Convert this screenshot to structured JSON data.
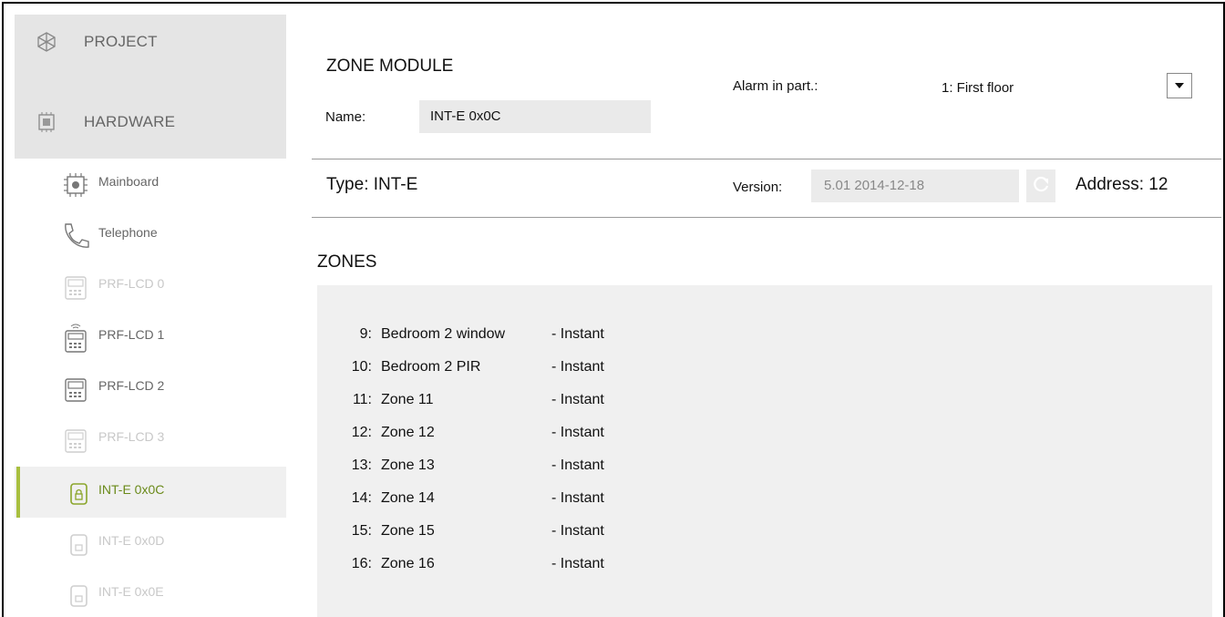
{
  "sidebar": {
    "project_label": "PROJECT",
    "hardware_label": "HARDWARE",
    "items": [
      {
        "label": "Mainboard",
        "icon": "mainboard-icon",
        "state": "normal"
      },
      {
        "label": "Telephone",
        "icon": "telephone-icon",
        "state": "normal"
      },
      {
        "label": "PRF-LCD 0",
        "icon": "keypad-icon",
        "state": "dim"
      },
      {
        "label": "PRF-LCD 1",
        "icon": "wireless-keypad-icon",
        "state": "normal"
      },
      {
        "label": "PRF-LCD 2",
        "icon": "keypad-icon",
        "state": "normal"
      },
      {
        "label": "PRF-LCD 3",
        "icon": "keypad-icon",
        "state": "dim"
      },
      {
        "label": "INT-E 0x0C",
        "icon": "module-icon",
        "state": "active"
      },
      {
        "label": "INT-E 0x0D",
        "icon": "module-icon",
        "state": "dim"
      },
      {
        "label": "INT-E 0x0E",
        "icon": "module-icon",
        "state": "dim"
      }
    ],
    "accent_color": "#a8bf3f"
  },
  "module": {
    "title": "ZONE MODULE",
    "name_label": "Name:",
    "name_value": "INT-E 0x0C",
    "alarm_label": "Alarm in part.:",
    "alarm_value": "1: First floor",
    "type_label": "Type:  INT-E",
    "version_label": "Version:",
    "version_value": "5.01 2014-12-18",
    "address_label": "Address:  12"
  },
  "zones": {
    "title": "ZONES",
    "rows": [
      {
        "num": "9:",
        "name": "Bedroom 2 window",
        "mode": "- Instant"
      },
      {
        "num": "10:",
        "name": "Bedroom 2 PIR",
        "mode": "- Instant"
      },
      {
        "num": "11:",
        "name": "Zone 11",
        "mode": "- Instant"
      },
      {
        "num": "12:",
        "name": "Zone 12",
        "mode": "- Instant"
      },
      {
        "num": "13:",
        "name": "Zone 13",
        "mode": "- Instant"
      },
      {
        "num": "14:",
        "name": "Zone 14",
        "mode": "- Instant"
      },
      {
        "num": "15:",
        "name": "Zone 15",
        "mode": "- Instant"
      },
      {
        "num": "16:",
        "name": "Zone 16",
        "mode": "- Instant"
      }
    ]
  }
}
